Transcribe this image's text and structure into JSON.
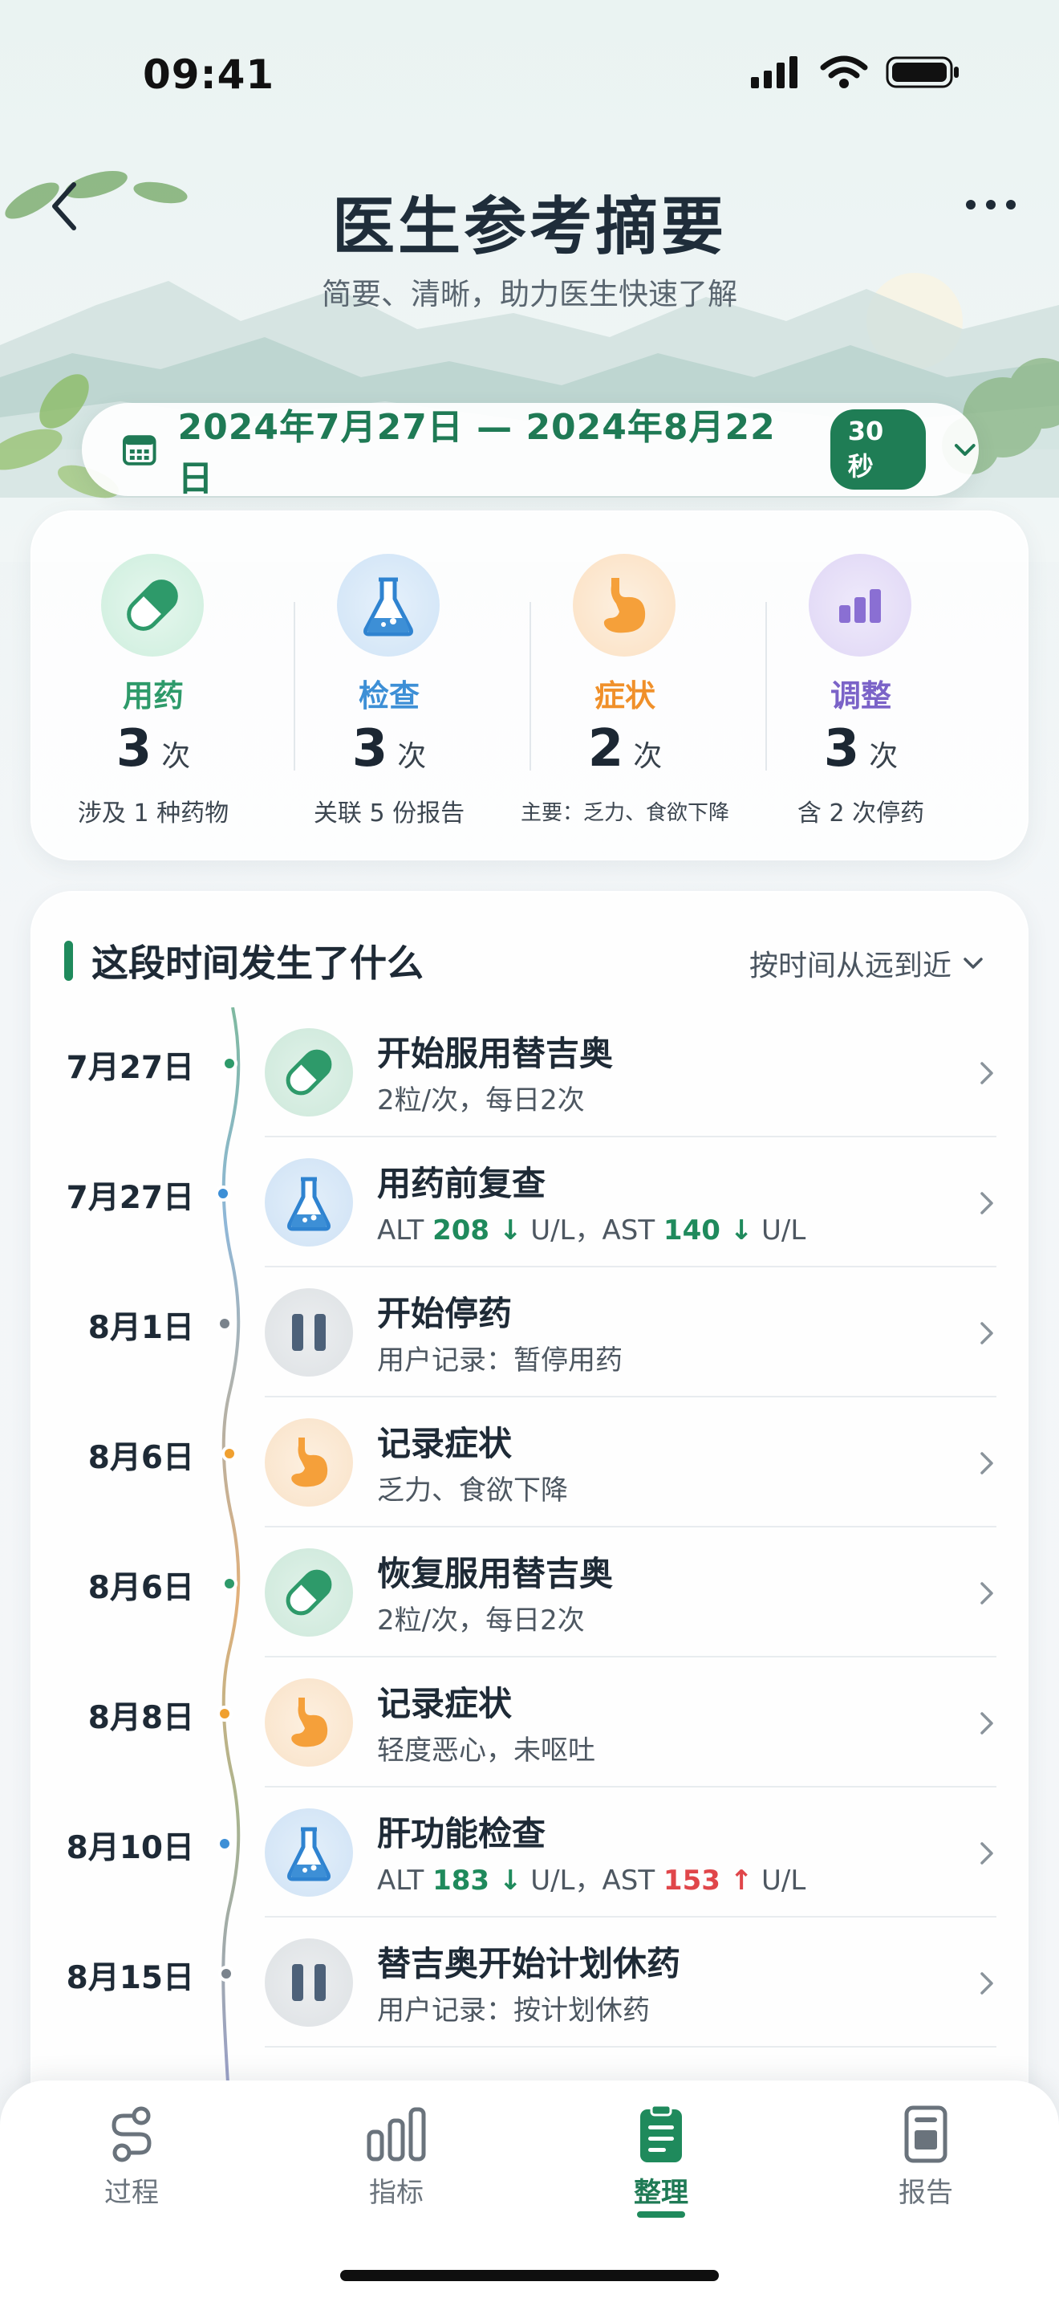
{
  "status": {
    "time": "09:41"
  },
  "header": {
    "title": "医生参考摘要",
    "subtitle": "简要、清晰，助力医生快速了解"
  },
  "date_range": {
    "text": "2024年7月27日 — 2024年8月22日",
    "duration_badge": "30秒"
  },
  "summary": [
    {
      "label": "用药",
      "count": "3",
      "unit": "次",
      "desc": "涉及 1 种药物",
      "color": "#2e9a6a",
      "icon": "capsule-icon"
    },
    {
      "label": "检查",
      "count": "3",
      "unit": "次",
      "desc": "关联 5 份报告",
      "color": "#3d8fd6",
      "icon": "flask-icon"
    },
    {
      "label": "症状",
      "count": "2",
      "unit": "次",
      "desc": "主要：乏力、食欲下降",
      "color": "#f0902a",
      "icon": "stomach-icon"
    },
    {
      "label": "调整",
      "count": "3",
      "unit": "次",
      "desc": "含 2 次停药",
      "color": "#7b63c8",
      "icon": "bar-chart-icon"
    }
  ],
  "timeline": {
    "title": "这段时间发生了什么",
    "sort_label": "按时间从远到近",
    "items": [
      {
        "date": "7月27日",
        "title": "开始服用替吉奥",
        "sub": "2粒/次，每日2次",
        "type": "med"
      },
      {
        "date": "7月27日",
        "title": "用药前复查",
        "sub_a": "ALT ",
        "val1": "208 ↓",
        "sub_b": " U/L，AST ",
        "val2": "140 ↓",
        "sub_c": " U/L",
        "type": "lab"
      },
      {
        "date": "8月1日",
        "title": "开始停药",
        "sub": "用户记录：暂停用药",
        "type": "pause"
      },
      {
        "date": "8月6日",
        "title": "记录症状",
        "sub": "乏力、食欲下降",
        "type": "sym"
      },
      {
        "date": "8月6日",
        "title": "恢复服用替吉奥",
        "sub": "2粒/次，每日2次",
        "type": "med"
      },
      {
        "date": "8月8日",
        "title": "记录症状",
        "sub": "轻度恶心，未呕吐",
        "type": "sym"
      },
      {
        "date": "8月10日",
        "title": "肝功能检查",
        "sub_a": "ALT ",
        "val1": "183 ↓",
        "sub_b": " U/L，AST ",
        "val2": "153 ↑",
        "sub_c": " U/L",
        "type": "lab"
      },
      {
        "date": "8月15日",
        "title": "替吉奥开始计划休药",
        "sub": "用户记录：按计划休药",
        "type": "pause"
      }
    ]
  },
  "tabs": [
    {
      "label": "过程",
      "icon": "process-icon"
    },
    {
      "label": "指标",
      "icon": "metrics-icon"
    },
    {
      "label": "整理",
      "icon": "clipboard-icon",
      "active": true
    },
    {
      "label": "报告",
      "icon": "report-icon"
    }
  ]
}
